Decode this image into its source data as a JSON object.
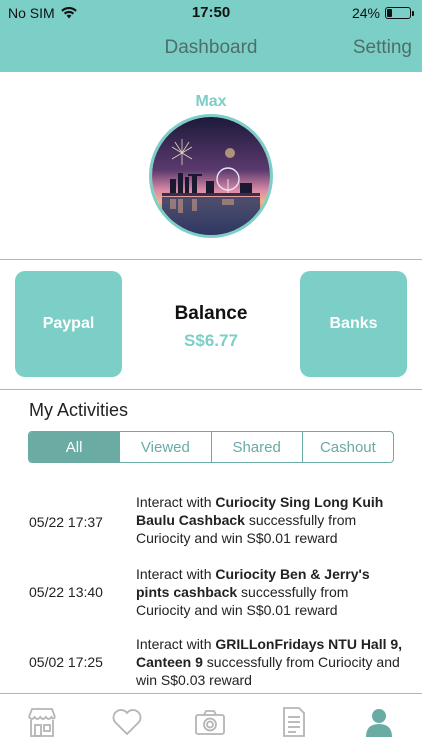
{
  "status_bar": {
    "carrier": "No SIM",
    "time": "17:50",
    "battery_percent": "24%",
    "battery_level": 0.24
  },
  "nav": {
    "title": "Dashboard",
    "setting_label": "Setting"
  },
  "profile": {
    "name": "Max",
    "avatar_icon": "city-skyline-fireworks-photo"
  },
  "balance": {
    "paypal_label": "Paypal",
    "label": "Balance",
    "value": "S$6.77",
    "banks_label": "Banks"
  },
  "activities": {
    "title": "My Activities",
    "filters": [
      "All",
      "Viewed",
      "Shared",
      "Cashout"
    ],
    "active_filter": "All",
    "items": [
      {
        "date": "05/22 17:37",
        "prefix": "Interact with ",
        "bold": "Curiocity Sing Long Kuih Baulu Cashback",
        "suffix": " successfully from Curiocity and win S$0.01 reward"
      },
      {
        "date": "05/22 13:40",
        "prefix": "Interact with ",
        "bold": "Curiocity Ben & Jerry's pints cashback",
        "suffix": " successfully from Curiocity and win S$0.01 reward"
      },
      {
        "date": "05/02 17:25",
        "prefix": "Interact with ",
        "bold": "GRILLonFridays NTU Hall 9, Canteen 9",
        "suffix": " successfully from Curiocity and win S$0.03 reward"
      }
    ]
  },
  "tab_bar": {
    "tabs": [
      "store-icon",
      "heart-icon",
      "camera-icon",
      "document-icon",
      "profile-icon"
    ],
    "active_tab": "profile-icon"
  },
  "colors": {
    "accent": "#7ccfc7",
    "segment": "#6aaba4",
    "nav_text": "#4e6e6b"
  }
}
